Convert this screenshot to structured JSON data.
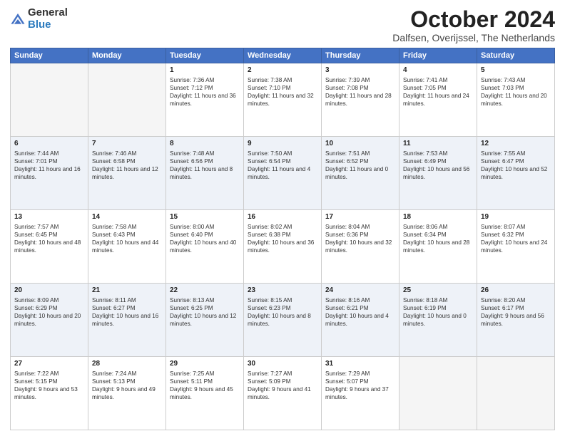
{
  "header": {
    "logo_general": "General",
    "logo_blue": "Blue",
    "month_title": "October 2024",
    "location": "Dalfsen, Overijssel, The Netherlands"
  },
  "days_of_week": [
    "Sunday",
    "Monday",
    "Tuesday",
    "Wednesday",
    "Thursday",
    "Friday",
    "Saturday"
  ],
  "weeks": [
    [
      {
        "day": "",
        "info": ""
      },
      {
        "day": "",
        "info": ""
      },
      {
        "day": "1",
        "info": "Sunrise: 7:36 AM\nSunset: 7:12 PM\nDaylight: 11 hours and 36 minutes."
      },
      {
        "day": "2",
        "info": "Sunrise: 7:38 AM\nSunset: 7:10 PM\nDaylight: 11 hours and 32 minutes."
      },
      {
        "day": "3",
        "info": "Sunrise: 7:39 AM\nSunset: 7:08 PM\nDaylight: 11 hours and 28 minutes."
      },
      {
        "day": "4",
        "info": "Sunrise: 7:41 AM\nSunset: 7:05 PM\nDaylight: 11 hours and 24 minutes."
      },
      {
        "day": "5",
        "info": "Sunrise: 7:43 AM\nSunset: 7:03 PM\nDaylight: 11 hours and 20 minutes."
      }
    ],
    [
      {
        "day": "6",
        "info": "Sunrise: 7:44 AM\nSunset: 7:01 PM\nDaylight: 11 hours and 16 minutes."
      },
      {
        "day": "7",
        "info": "Sunrise: 7:46 AM\nSunset: 6:58 PM\nDaylight: 11 hours and 12 minutes."
      },
      {
        "day": "8",
        "info": "Sunrise: 7:48 AM\nSunset: 6:56 PM\nDaylight: 11 hours and 8 minutes."
      },
      {
        "day": "9",
        "info": "Sunrise: 7:50 AM\nSunset: 6:54 PM\nDaylight: 11 hours and 4 minutes."
      },
      {
        "day": "10",
        "info": "Sunrise: 7:51 AM\nSunset: 6:52 PM\nDaylight: 11 hours and 0 minutes."
      },
      {
        "day": "11",
        "info": "Sunrise: 7:53 AM\nSunset: 6:49 PM\nDaylight: 10 hours and 56 minutes."
      },
      {
        "day": "12",
        "info": "Sunrise: 7:55 AM\nSunset: 6:47 PM\nDaylight: 10 hours and 52 minutes."
      }
    ],
    [
      {
        "day": "13",
        "info": "Sunrise: 7:57 AM\nSunset: 6:45 PM\nDaylight: 10 hours and 48 minutes."
      },
      {
        "day": "14",
        "info": "Sunrise: 7:58 AM\nSunset: 6:43 PM\nDaylight: 10 hours and 44 minutes."
      },
      {
        "day": "15",
        "info": "Sunrise: 8:00 AM\nSunset: 6:40 PM\nDaylight: 10 hours and 40 minutes."
      },
      {
        "day": "16",
        "info": "Sunrise: 8:02 AM\nSunset: 6:38 PM\nDaylight: 10 hours and 36 minutes."
      },
      {
        "day": "17",
        "info": "Sunrise: 8:04 AM\nSunset: 6:36 PM\nDaylight: 10 hours and 32 minutes."
      },
      {
        "day": "18",
        "info": "Sunrise: 8:06 AM\nSunset: 6:34 PM\nDaylight: 10 hours and 28 minutes."
      },
      {
        "day": "19",
        "info": "Sunrise: 8:07 AM\nSunset: 6:32 PM\nDaylight: 10 hours and 24 minutes."
      }
    ],
    [
      {
        "day": "20",
        "info": "Sunrise: 8:09 AM\nSunset: 6:29 PM\nDaylight: 10 hours and 20 minutes."
      },
      {
        "day": "21",
        "info": "Sunrise: 8:11 AM\nSunset: 6:27 PM\nDaylight: 10 hours and 16 minutes."
      },
      {
        "day": "22",
        "info": "Sunrise: 8:13 AM\nSunset: 6:25 PM\nDaylight: 10 hours and 12 minutes."
      },
      {
        "day": "23",
        "info": "Sunrise: 8:15 AM\nSunset: 6:23 PM\nDaylight: 10 hours and 8 minutes."
      },
      {
        "day": "24",
        "info": "Sunrise: 8:16 AM\nSunset: 6:21 PM\nDaylight: 10 hours and 4 minutes."
      },
      {
        "day": "25",
        "info": "Sunrise: 8:18 AM\nSunset: 6:19 PM\nDaylight: 10 hours and 0 minutes."
      },
      {
        "day": "26",
        "info": "Sunrise: 8:20 AM\nSunset: 6:17 PM\nDaylight: 9 hours and 56 minutes."
      }
    ],
    [
      {
        "day": "27",
        "info": "Sunrise: 7:22 AM\nSunset: 5:15 PM\nDaylight: 9 hours and 53 minutes."
      },
      {
        "day": "28",
        "info": "Sunrise: 7:24 AM\nSunset: 5:13 PM\nDaylight: 9 hours and 49 minutes."
      },
      {
        "day": "29",
        "info": "Sunrise: 7:25 AM\nSunset: 5:11 PM\nDaylight: 9 hours and 45 minutes."
      },
      {
        "day": "30",
        "info": "Sunrise: 7:27 AM\nSunset: 5:09 PM\nDaylight: 9 hours and 41 minutes."
      },
      {
        "day": "31",
        "info": "Sunrise: 7:29 AM\nSunset: 5:07 PM\nDaylight: 9 hours and 37 minutes."
      },
      {
        "day": "",
        "info": ""
      },
      {
        "day": "",
        "info": ""
      }
    ]
  ]
}
